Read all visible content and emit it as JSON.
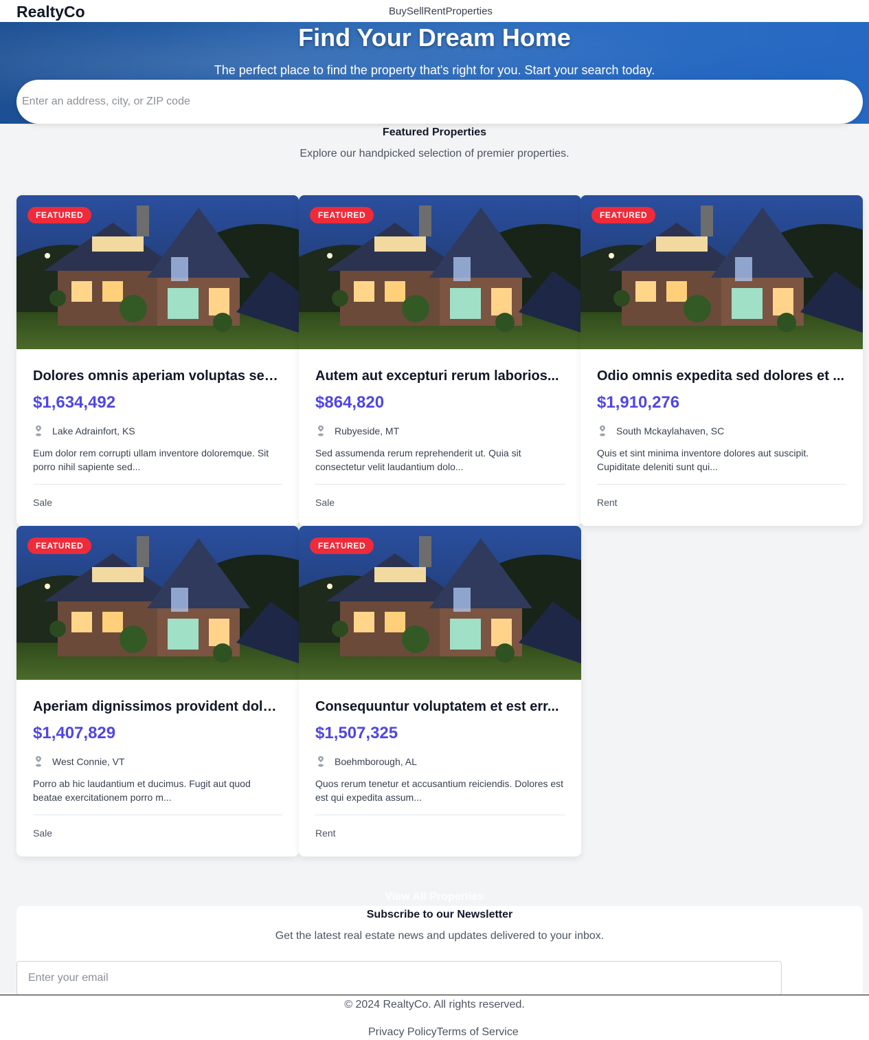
{
  "header": {
    "logo": "RealtyCo",
    "nav": [
      "Buy",
      "Sell",
      "Rent",
      "Properties"
    ]
  },
  "hero": {
    "title": "Find Your Dream Home",
    "subtitle": "The perfect place to find the property that's right for you. Start your search today.",
    "search_placeholder": "Enter an address, city, or ZIP code"
  },
  "featured": {
    "title": "Featured Properties",
    "subtitle": "Explore our handpicked selection of premier properties.",
    "badge": "FEATURED",
    "cards": [
      {
        "title": "Dolores omnis aperiam voluptas sed...",
        "price": "$1,634,492",
        "location": "Lake Adrainfort, KS",
        "description": "Eum dolor rem corrupti ullam inventore doloremque. Sit porro nihil sapiente sed...",
        "type": "Sale"
      },
      {
        "title": "Autem aut excepturi rerum laborios...",
        "price": "$864,820",
        "location": "Rubyeside, MT",
        "description": "Sed assumenda rerum reprehenderit ut. Quia sit consectetur velit laudantium dolo...",
        "type": "Sale"
      },
      {
        "title": "Odio omnis expedita sed dolores et ...",
        "price": "$1,910,276",
        "location": "South Mckaylahaven, SC",
        "description": "Quis et sint minima inventore dolores aut suscipit. Cupiditate deleniti sunt qui...",
        "type": "Rent"
      },
      {
        "title": "Aperiam dignissimos provident dolo...",
        "price": "$1,407,829",
        "location": "West Connie, VT",
        "description": "Porro ab hic laudantium et ducimus. Fugit aut quod beatae exercitationem porro m...",
        "type": "Sale"
      },
      {
        "title": "Consequuntur voluptatem et est err...",
        "price": "$1,507,325",
        "location": "Boehmborough, AL",
        "description": "Quos rerum tenetur et accusantium reiciendis. Dolores est est qui expedita assum...",
        "type": "Rent"
      }
    ],
    "view_all": "View All Properties"
  },
  "newsletter": {
    "title": "Subscribe to our Newsletter",
    "subtitle": "Get the latest real estate news and updates delivered to your inbox.",
    "email_placeholder": "Enter your email"
  },
  "footer": {
    "copyright": "© 2024 RealtyCo. All rights reserved.",
    "links": [
      "Privacy Policy",
      "Terms of Service"
    ]
  },
  "colors": {
    "accent_price": "#4f46e5",
    "badge": "#ef2b3a",
    "hero": "#1f5fb0"
  }
}
